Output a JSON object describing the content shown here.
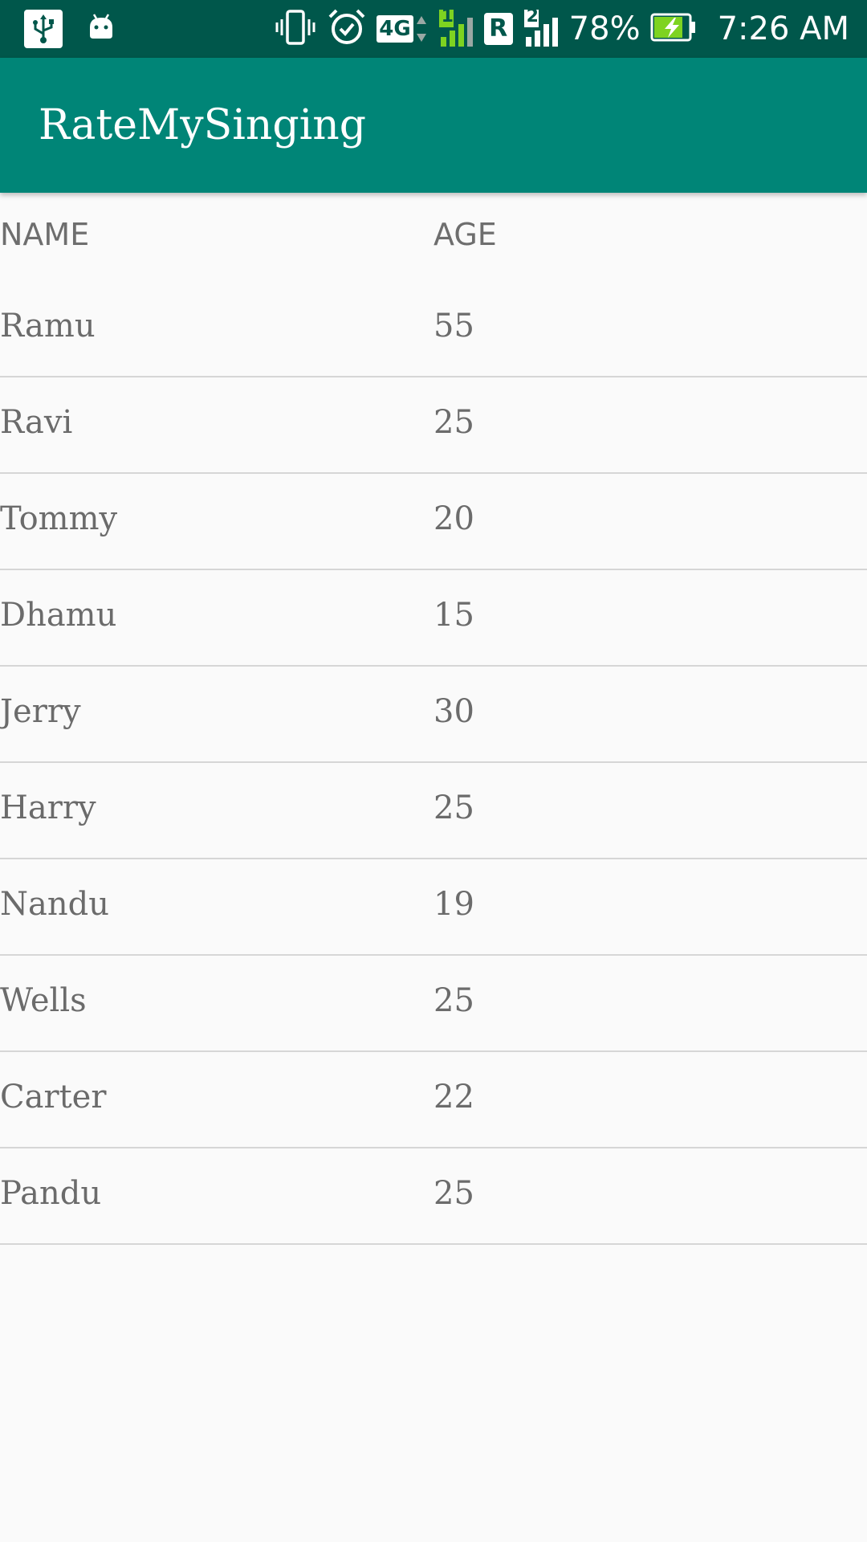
{
  "status_bar": {
    "battery": "78%",
    "time": "7:26 AM",
    "network_type": "4G",
    "sim1_label": "1",
    "sim2_label": "2",
    "roaming_label": "R",
    "icons": [
      "usb-icon",
      "android-debug-icon",
      "vibrate-icon",
      "alarm-icon",
      "network-4g-icon",
      "signal-sim1-icon",
      "roaming-icon",
      "signal-sim2-icon",
      "battery-charging-icon"
    ],
    "colors": {
      "background": "#00574b",
      "signal_accent": "#7ed321",
      "battery_accent": "#7ed321"
    }
  },
  "app_bar": {
    "title": "RateMySinging",
    "color": "#008577"
  },
  "table": {
    "headers": {
      "name": "NAME",
      "age": "AGE"
    },
    "rows": [
      {
        "name": "Ramu",
        "age": "55"
      },
      {
        "name": "Ravi",
        "age": "25"
      },
      {
        "name": "Tommy",
        "age": "20"
      },
      {
        "name": "Dhamu",
        "age": "15"
      },
      {
        "name": "Jerry",
        "age": "30"
      },
      {
        "name": "Harry",
        "age": "25"
      },
      {
        "name": "Nandu",
        "age": "19"
      },
      {
        "name": "Wells",
        "age": "25"
      },
      {
        "name": "Carter",
        "age": "22"
      },
      {
        "name": "Pandu",
        "age": "25"
      }
    ]
  }
}
